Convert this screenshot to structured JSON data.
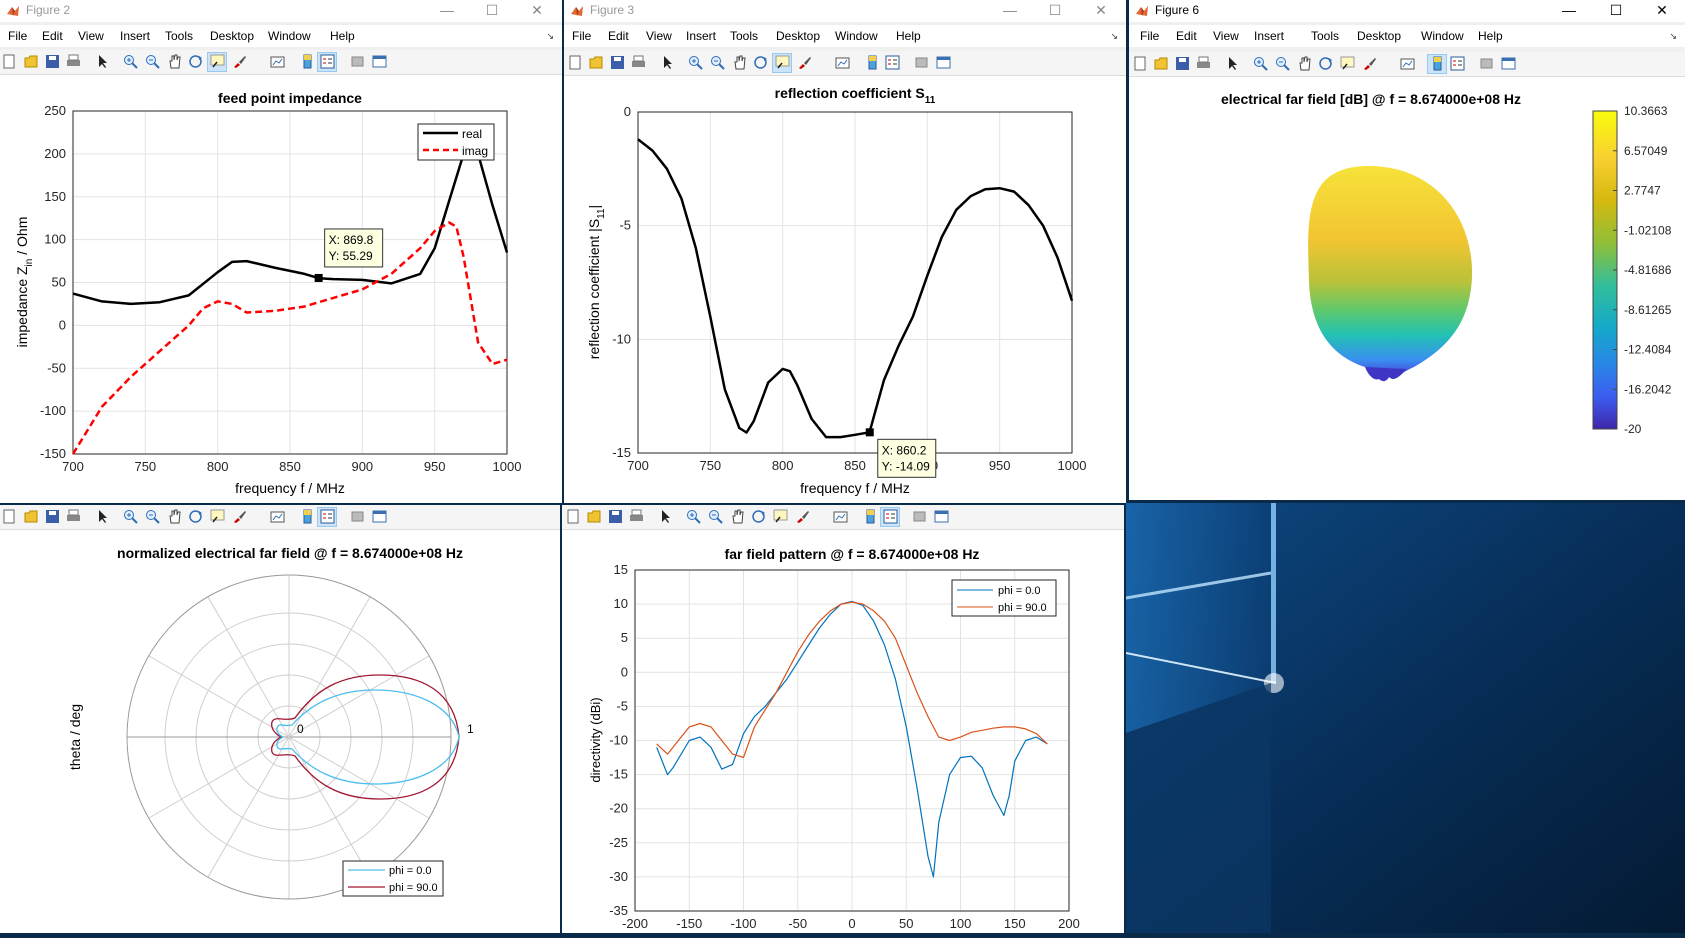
{
  "app": {
    "menu": [
      "File",
      "Edit",
      "View",
      "Insert",
      "Tools",
      "Desktop",
      "Window",
      "Help"
    ],
    "icons": [
      "new-figure-icon",
      "open-file-icon",
      "save-icon",
      "print-icon",
      "pointer-icon",
      "zoom-in-icon",
      "zoom-out-icon",
      "pan-icon",
      "rotate-icon",
      "data-cursor-icon",
      "brush-icon",
      "link-plot-icon",
      "colorbar-icon",
      "legend-icon",
      "hide-plot-tools-icon",
      "show-plot-tools-icon"
    ]
  },
  "windows": {
    "fig2": {
      "title": "Figure 2"
    },
    "fig3": {
      "title": "Figure 3"
    },
    "fig6": {
      "title": "Figure 6"
    }
  },
  "colors": {
    "black": "#000000",
    "red": "#ff0000",
    "blue": "#0072bd",
    "orange": "#d95319",
    "polar_blue": "#4dbeee",
    "polar_red": "#a2142f"
  },
  "chart_data": [
    {
      "id": "impedance",
      "type": "line",
      "title": "feed point impedance",
      "xlabel": "frequency f / MHz",
      "ylabel_main": "impedance Z",
      "ylabel_sub": "in",
      "ylabel_tail": " / Ohm",
      "xlim": [
        700,
        1000
      ],
      "ylim": [
        -150,
        250
      ],
      "xticks": [
        700,
        750,
        800,
        850,
        900,
        950,
        1000
      ],
      "yticks": [
        -150,
        -100,
        -50,
        0,
        50,
        100,
        150,
        200,
        250
      ],
      "grid": true,
      "legend_position": "top-right",
      "series": [
        {
          "name": "real",
          "x": [
            700,
            720,
            740,
            760,
            780,
            800,
            810,
            820,
            840,
            860,
            870,
            880,
            900,
            920,
            940,
            950,
            960,
            970,
            975,
            980,
            990,
            1000
          ],
          "y": [
            37,
            28,
            25,
            27,
            35,
            62,
            74,
            75,
            67,
            60,
            55,
            54,
            53,
            49,
            60,
            90,
            145,
            200,
            215,
            200,
            140,
            85
          ]
        },
        {
          "name": "imag",
          "x": [
            700,
            720,
            740,
            760,
            780,
            790,
            800,
            810,
            820,
            840,
            860,
            880,
            900,
            920,
            940,
            950,
            960,
            965,
            970,
            980,
            990,
            1000
          ],
          "y": [
            -150,
            -95,
            -60,
            -30,
            0,
            20,
            28,
            25,
            15,
            17,
            22,
            32,
            42,
            60,
            90,
            110,
            120,
            115,
            80,
            -20,
            -45,
            -40
          ]
        }
      ],
      "datatip": {
        "x": 869.8,
        "y": 55.29,
        "x_text": "X: 869.8",
        "y_text": "Y: 55.29"
      }
    },
    {
      "id": "s11",
      "type": "line",
      "title_main": "reflection coefficient S",
      "title_sub": "11",
      "xlabel": "frequency f / MHz",
      "ylabel_main": "reflection coefficient |S",
      "ylabel_sub": "11",
      "ylabel_tail": "|",
      "xlim": [
        700,
        1000
      ],
      "ylim": [
        -15,
        0
      ],
      "xticks": [
        700,
        750,
        800,
        850,
        900,
        950,
        1000
      ],
      "yticks": [
        -15,
        -10,
        -5,
        0
      ],
      "grid": true,
      "series": [
        {
          "name": "S11",
          "x": [
            700,
            710,
            720,
            730,
            740,
            750,
            760,
            770,
            775,
            780,
            790,
            800,
            805,
            810,
            820,
            830,
            840,
            850,
            860,
            870,
            880,
            890,
            900,
            910,
            920,
            930,
            940,
            950,
            960,
            970,
            980,
            990,
            1000
          ],
          "y": [
            -1.2,
            -1.7,
            -2.5,
            -3.8,
            -6.0,
            -9.0,
            -12.2,
            -13.9,
            -14.1,
            -13.6,
            -11.9,
            -11.3,
            -11.4,
            -12.0,
            -13.5,
            -14.3,
            -14.3,
            -14.2,
            -14.09,
            -11.8,
            -10.3,
            -9.0,
            -7.2,
            -5.5,
            -4.3,
            -3.7,
            -3.4,
            -3.35,
            -3.5,
            -4.1,
            -5.0,
            -6.4,
            -8.3
          ]
        }
      ],
      "datatip": {
        "x": 860.2,
        "y": -14.09,
        "x_text": "X: 860.2",
        "y_text": "Y: -14.09"
      }
    },
    {
      "id": "farfield3d",
      "type": "heatmap",
      "title": "electrical far field [dB] @ f = 8.674000e+08 Hz",
      "colorbar_ticks": [
        "10.3663",
        "6.57049",
        "2.7747",
        "-1.02108",
        "-4.81686",
        "-8.61265",
        "-12.4084",
        "-16.2042",
        "-20"
      ],
      "clim": [
        -20,
        10.3663
      ]
    },
    {
      "id": "polar",
      "type": "line",
      "title": "normalized electrical far field @ f = 8.674000e+08 Hz",
      "ylabel": "theta / deg",
      "rlim": [
        0,
        1
      ],
      "r_tick_labels": [
        "0",
        "1"
      ],
      "legend_position": "bottom",
      "series": [
        {
          "name": "phi = 0.0"
        },
        {
          "name": "phi = 90.0"
        }
      ]
    },
    {
      "id": "pattern",
      "type": "line",
      "title": "far field pattern @ f = 8.674000e+08 Hz",
      "ylabel": "directivity (dBi)",
      "xlim": [
        -200,
        200
      ],
      "ylim": [
        -35,
        15
      ],
      "xticks": [
        -200,
        -150,
        -100,
        -50,
        0,
        50,
        100,
        150,
        200
      ],
      "yticks": [
        -35,
        -30,
        -25,
        -20,
        -15,
        -10,
        -5,
        0,
        5,
        10,
        15
      ],
      "grid": true,
      "legend_position": "top-right",
      "series": [
        {
          "name": "phi = 0.0",
          "x": [
            -180,
            -170,
            -165,
            -150,
            -140,
            -130,
            -120,
            -110,
            -100,
            -90,
            -80,
            -70,
            -60,
            -50,
            -40,
            -30,
            -20,
            -10,
            0,
            10,
            20,
            30,
            40,
            50,
            60,
            70,
            75,
            80,
            90,
            100,
            110,
            120,
            130,
            140,
            145,
            150,
            160,
            170,
            180
          ],
          "y": [
            -11,
            -15,
            -14,
            -10,
            -9.5,
            -11,
            -14.2,
            -13.5,
            -9,
            -6.5,
            -5,
            -3,
            -1,
            1.5,
            4,
            6.5,
            8.5,
            10,
            10.4,
            9.8,
            7.5,
            4,
            -1,
            -8,
            -17,
            -27,
            -30,
            -22,
            -15,
            -12.5,
            -12.3,
            -14,
            -18,
            -21,
            -18,
            -13,
            -10,
            -9.5,
            -10.5
          ]
        },
        {
          "name": "phi = 90.0",
          "x": [
            -180,
            -170,
            -160,
            -150,
            -140,
            -130,
            -120,
            -110,
            -100,
            -90,
            -80,
            -70,
            -60,
            -50,
            -40,
            -30,
            -20,
            -10,
            0,
            10,
            20,
            30,
            40,
            50,
            60,
            70,
            80,
            90,
            100,
            110,
            120,
            130,
            140,
            150,
            160,
            170,
            180
          ],
          "y": [
            -10.5,
            -12,
            -10,
            -8,
            -7.5,
            -8,
            -10,
            -12,
            -12.5,
            -8,
            -5.5,
            -3,
            0,
            3,
            5.5,
            7.5,
            9,
            10,
            10.3,
            10,
            9,
            7.5,
            5,
            1,
            -3,
            -6.5,
            -9.5,
            -10,
            -9.5,
            -8.8,
            -8.5,
            -8.2,
            -8,
            -8,
            -8.3,
            -9,
            -10.5
          ]
        }
      ]
    }
  ]
}
